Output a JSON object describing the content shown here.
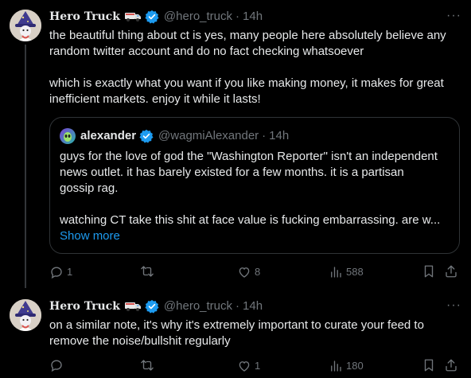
{
  "tweets": [
    {
      "author": {
        "name": "Hero Truck",
        "handle": "@hero_truck",
        "time": "14h"
      },
      "text": "the beautiful thing about ct is yes, many people here absolutely believe any\nrandom twitter account and do no fact checking whatsoever\n\nwhich is exactly what you want if you like making money, it makes for great\ninefficient markets. enjoy it while it lasts!",
      "quote": {
        "author": {
          "name": "alexander",
          "handle": "@wagmiAlexander",
          "time": "14h"
        },
        "text": "guys for the love of god the \"Washington Reporter\" isn't an independent\nnews outlet. it has barely existed for a few months. it is a partisan\ngossip rag.\n\nwatching CT take this shit at face value is fucking embarrassing. are w...",
        "show_more": "Show more"
      },
      "stats": {
        "replies": "1",
        "reposts": "",
        "likes": "8",
        "views": "588"
      }
    },
    {
      "author": {
        "name": "Hero Truck",
        "handle": "@hero_truck",
        "time": "14h"
      },
      "text": "on a similar note, it's why it's extremely important to curate your feed to\nremove the noise/bullshit regularly",
      "stats": {
        "replies": "",
        "reposts": "",
        "likes": "1",
        "views": "180"
      }
    }
  ],
  "ui": {
    "more_glyph": "···",
    "separator": "·"
  },
  "colors": {
    "background": "#000000",
    "text": "#e7e9ea",
    "muted": "#71767b",
    "link": "#1d9bf0",
    "border": "#2f3336"
  }
}
